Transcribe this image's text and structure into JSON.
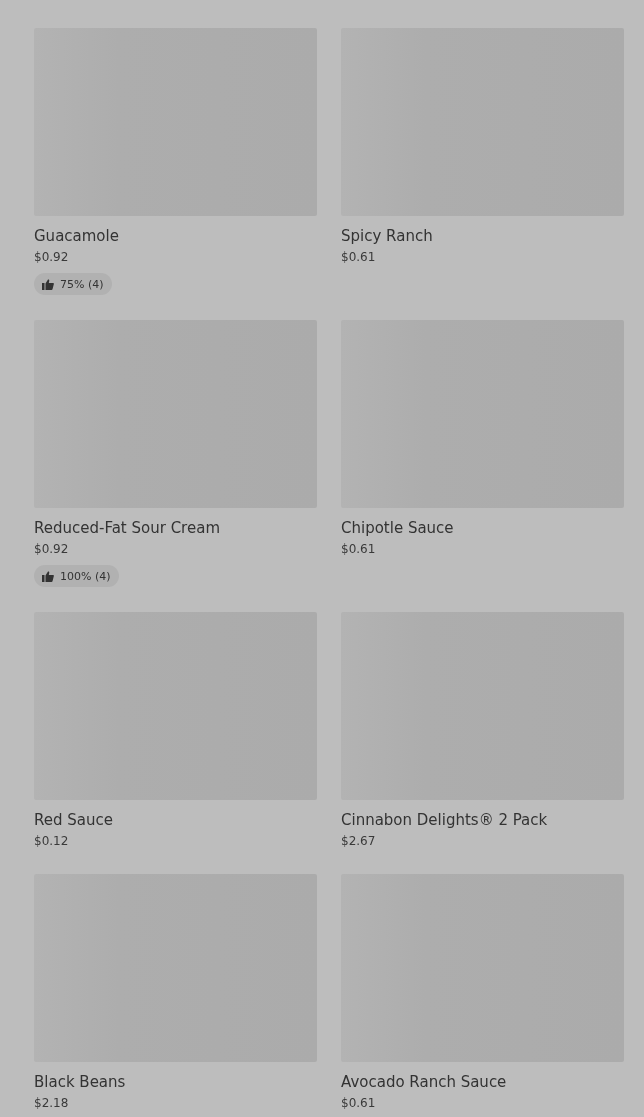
{
  "items": [
    {
      "name": "Guacamole",
      "price": "$0.92",
      "rating": "75% (4)"
    },
    {
      "name": "Spicy Ranch",
      "price": "$0.61"
    },
    {
      "name": "Reduced-Fat Sour Cream",
      "price": "$0.92",
      "rating": "100% (4)"
    },
    {
      "name": "Chipotle Sauce",
      "price": "$0.61"
    },
    {
      "name": "Red Sauce",
      "price": "$0.12"
    },
    {
      "name": "Cinnabon Delights® 2 Pack",
      "price": "$2.67"
    },
    {
      "name": "Black Beans",
      "price": "$2.18"
    },
    {
      "name": "Avocado Ranch Sauce",
      "price": "$0.61"
    }
  ]
}
